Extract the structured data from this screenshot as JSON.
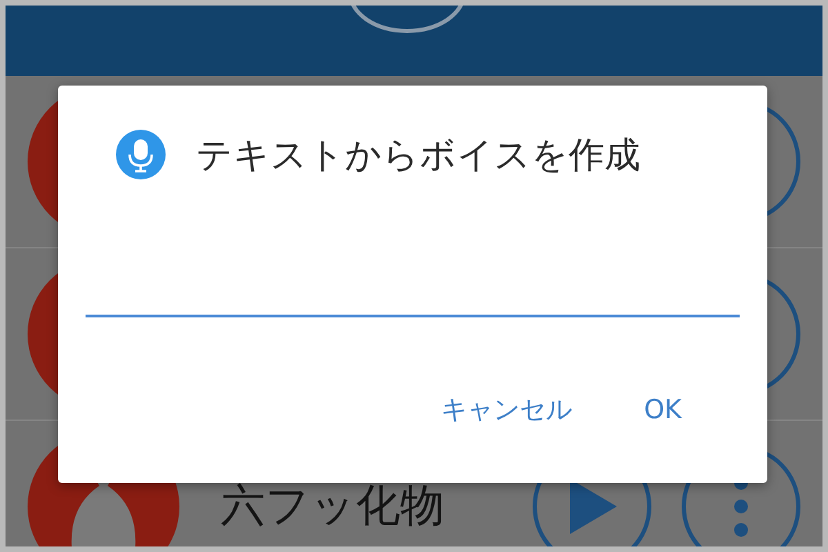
{
  "list": {
    "rows": [
      {
        "title": "六フッ化物"
      }
    ]
  },
  "dialog": {
    "title": "テキストからボイスを作成",
    "buttons": [
      "キャンセル",
      "OK"
    ]
  }
}
